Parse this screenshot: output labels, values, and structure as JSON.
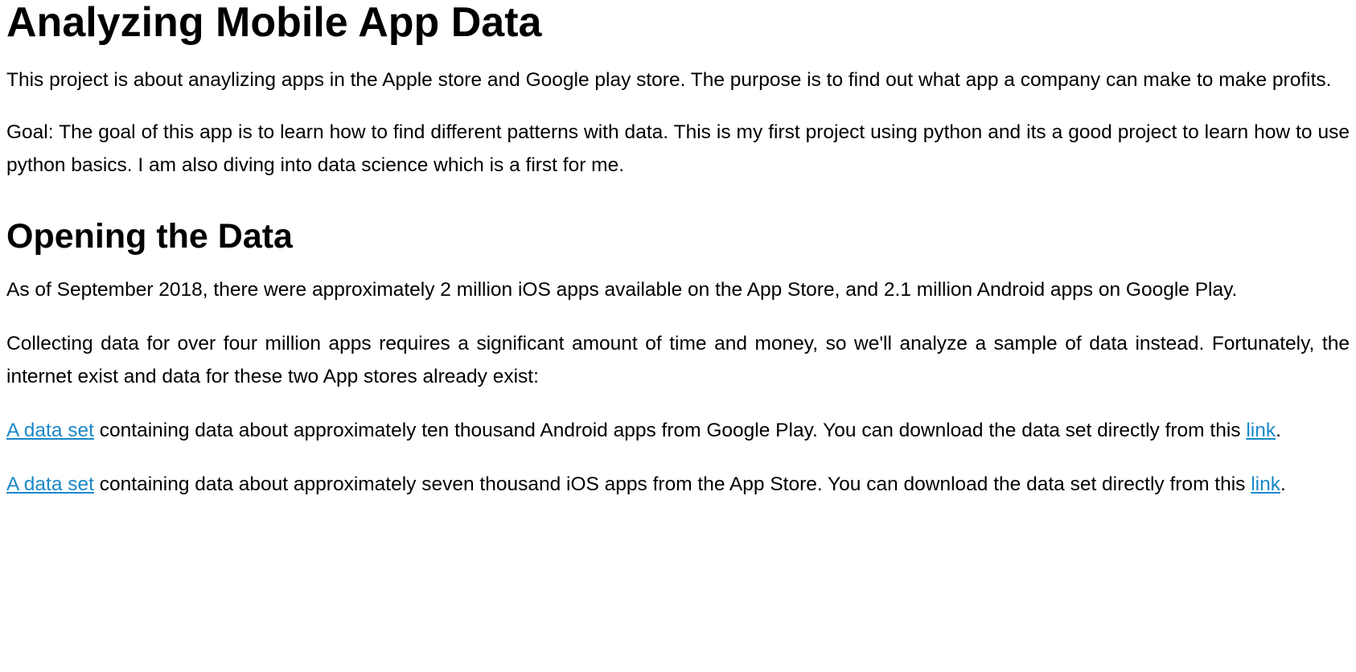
{
  "title": "Analyzing Mobile App Data",
  "intro": "This project is about anaylizing apps in the Apple store and Google play store. The purpose is to find out what app a company can make to make profits.",
  "goal": "Goal: The goal of this app is to learn how to find different patterns with data. This is my first project using python and its a good project to learn how to use python basics. I am also diving into data science which is a first for me.",
  "section_heading": "Opening the Data",
  "app_counts": "As of September 2018, there were approximately 2 million iOS apps available on the App Store, and 2.1 million Android apps on Google Play.",
  "collecting": "Collecting data for over four million apps requires a significant amount of time and money, so we'll analyze a sample of data instead. Fortunately, the internet exist and data for these two App stores already exist:",
  "android_dataset": {
    "link_text": "A data set",
    "text": " containing data about approximately ten thousand Android apps from Google Play. You can download the data set directly from this ",
    "download_link_text": "link",
    "end": "."
  },
  "ios_dataset": {
    "link_text": "A data set",
    "text": " containing data about approximately seven thousand iOS apps from the App Store. You can download the data set directly from this ",
    "download_link_text": "link",
    "end": "."
  },
  "colors": {
    "link": "#1a88c9",
    "text": "#000000",
    "background": "#ffffff"
  }
}
